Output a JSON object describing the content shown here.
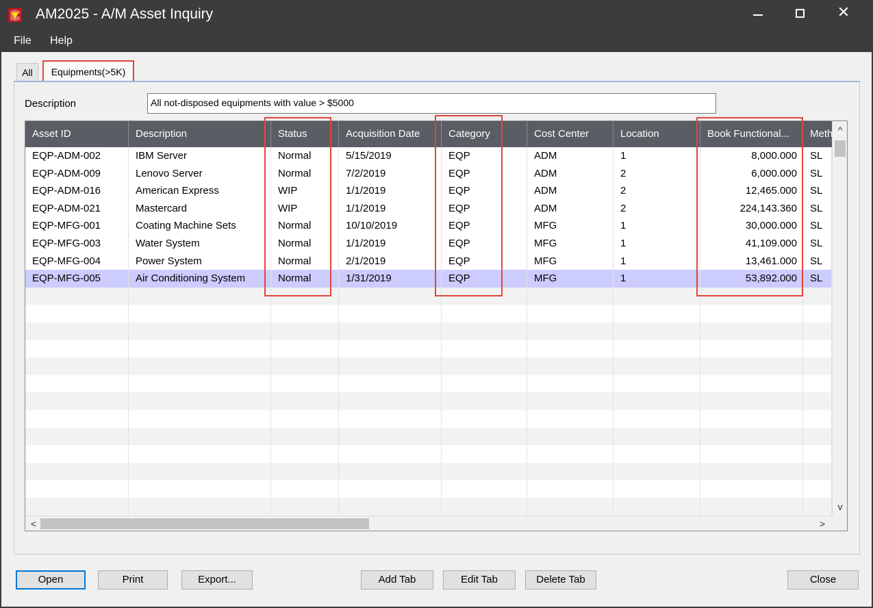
{
  "window": {
    "title": "AM2025 - A/M Asset Inquiry",
    "minimize_glyph": "",
    "close_glyph": "✕"
  },
  "menu": {
    "file": "File",
    "help": "Help"
  },
  "tabs": [
    {
      "label": "All"
    },
    {
      "label": "Equipments(>5K)"
    }
  ],
  "description": {
    "label": "Description",
    "value": "All not-disposed equipments with value > $5000"
  },
  "grid": {
    "columns": [
      "Asset ID",
      "Description",
      "Status",
      "Acquisition Date",
      "Category",
      "Cost Center",
      "Location",
      "Book Functional...",
      "Meth"
    ],
    "rows": [
      [
        "EQP-ADM-002",
        "IBM Server",
        "Normal",
        "5/15/2019",
        "EQP",
        "ADM",
        "1",
        "8,000.000",
        "SL"
      ],
      [
        "EQP-ADM-009",
        "Lenovo Server",
        "Normal",
        "7/2/2019",
        "EQP",
        "ADM",
        "2",
        "6,000.000",
        "SL"
      ],
      [
        "EQP-ADM-016",
        "American Express",
        "WIP",
        "1/1/2019",
        "EQP",
        "ADM",
        "2",
        "12,465.000",
        "SL"
      ],
      [
        "EQP-ADM-021",
        "Mastercard",
        "WIP",
        "1/1/2019",
        "EQP",
        "ADM",
        "2",
        "224,143.360",
        "SL"
      ],
      [
        "EQP-MFG-001",
        "Coating Machine Sets",
        "Normal",
        "10/10/2019",
        "EQP",
        "MFG",
        "1",
        "30,000.000",
        "SL"
      ],
      [
        "EQP-MFG-003",
        "Water System",
        "Normal",
        "1/1/2019",
        "EQP",
        "MFG",
        "1",
        "41,109.000",
        "SL"
      ],
      [
        "EQP-MFG-004",
        "Power System",
        "Normal",
        "2/1/2019",
        "EQP",
        "MFG",
        "1",
        "13,461.000",
        "SL"
      ],
      [
        "EQP-MFG-005",
        "Air Conditioning System",
        "Normal",
        "1/31/2019",
        "EQP",
        "MFG",
        "1",
        "53,892.000",
        "SL"
      ]
    ],
    "selected_row": 7,
    "empty_rows": 13
  },
  "buttons": {
    "open": "Open",
    "print": "Print",
    "export": "Export...",
    "add_tab": "Add Tab",
    "edit_tab": "Edit Tab",
    "delete_tab": "Delete Tab",
    "close": "Close"
  },
  "colors": {
    "titlebar": "#3c3c3c",
    "grid_header": "#5a5d64",
    "selected_row": "#ccccff",
    "highlight": "#e0463c",
    "focus": "#0078d7"
  },
  "icons": {
    "app": "red-asset-icon",
    "scroll_up": "^",
    "scroll_down": "v",
    "scroll_left": "<",
    "scroll_right": ">"
  }
}
